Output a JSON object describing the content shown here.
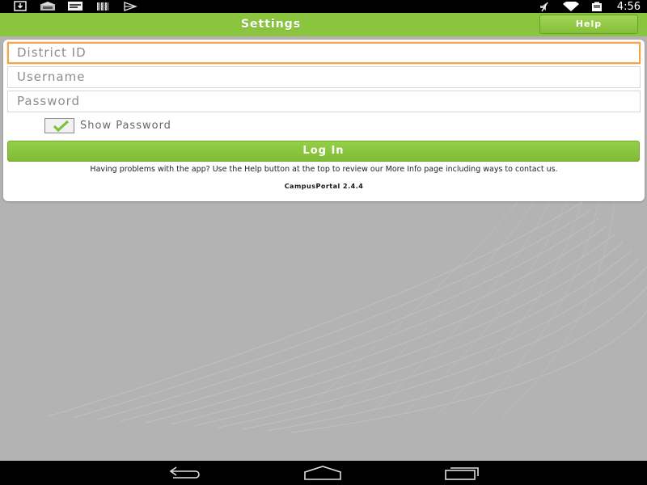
{
  "status_bar": {
    "time": "4:56",
    "left_icons": [
      "download-icon",
      "media-icon",
      "image-icon",
      "barcode-icon",
      "playstore-icon"
    ],
    "right_icons": [
      "mute-icon",
      "wifi-icon",
      "battery-icon"
    ]
  },
  "action_bar": {
    "title": "Settings",
    "help_label": "Help"
  },
  "form": {
    "district_id_placeholder": "District ID",
    "username_placeholder": "Username",
    "password_placeholder": "Password",
    "show_password_label": "Show Password",
    "show_password_checked": true,
    "login_label": "Log In",
    "help_text": "Having problems with the app? Use the Help button at the top to review our More Info page including ways to contact us.",
    "version": "CampusPortal 2.4.4"
  },
  "nav_bar": {
    "buttons": [
      "back-icon",
      "home-icon",
      "recents-icon"
    ]
  },
  "colors": {
    "accent_green": "#8bc53f",
    "focus_orange": "#f0a64a",
    "background_gray": "#b3b3b3"
  }
}
